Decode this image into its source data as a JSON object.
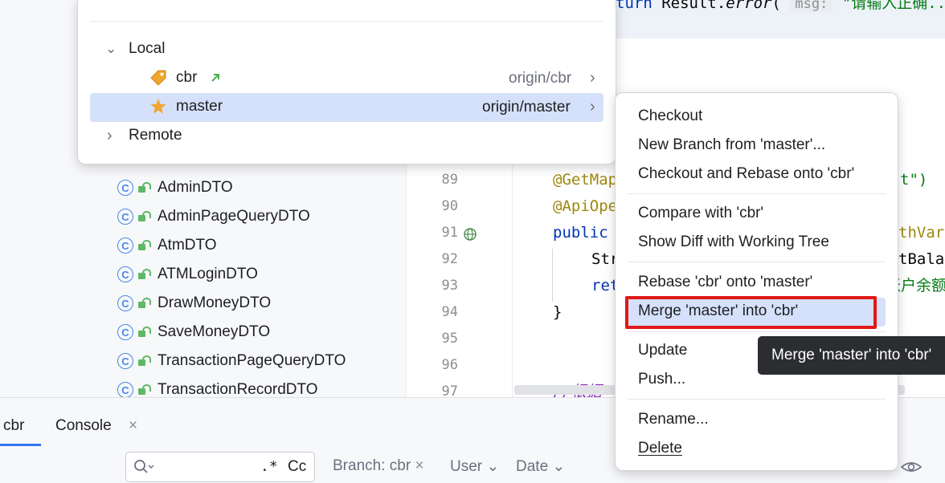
{
  "tree": {
    "items": [
      {
        "label": "AdminDTO"
      },
      {
        "label": "AdminPageQueryDTO"
      },
      {
        "label": "AtmDTO"
      },
      {
        "label": "ATMLoginDTO"
      },
      {
        "label": "DrawMoneyDTO"
      },
      {
        "label": "SaveMoneyDTO"
      },
      {
        "label": "TransactionPageQueryDTO"
      },
      {
        "label": "TransactionRecordDTO"
      }
    ],
    "class_glyph": "C",
    "class_icon": "class-icon",
    "access_icon": "lock-icon"
  },
  "editor": {
    "top_line": {
      "kw": "turn",
      "plain": " Result.",
      "method": "error",
      "paren": "(",
      "hint": "msg:",
      "str": "\"请输入正确..."
    },
    "line_numbers": [
      "89",
      "90",
      "91",
      "92",
      "93",
      "94",
      "95",
      "96",
      "97"
    ],
    "lines": {
      "l89_annot": "@GetMap",
      "l89_tail": "\")",
      "l89_tail_str": "t",
      "l90_annot": "@ApiOpe",
      "l91_kw": "public",
      "l91_tail": "thVar",
      "l92_plain": "Str",
      "l92_tail": "tBala",
      "l93_kw": "ret",
      "l93_tail": "账户余额",
      "l94_plain": "}",
      "l97_cmt": "//根据"
    }
  },
  "branches_popup": {
    "local_label": "Local",
    "remote_label": "Remote",
    "branches": [
      {
        "name": "cbr",
        "tracking": "origin/cbr",
        "icon": "tag-icon",
        "status_icon": "outgoing-arrow-icon"
      },
      {
        "name": "master",
        "tracking": "origin/master",
        "icon": "star-icon",
        "selected": true
      }
    ]
  },
  "context_menu": {
    "items": [
      {
        "label": "Checkout"
      },
      {
        "label": "New Branch from 'master'..."
      },
      {
        "label": "Checkout and Rebase onto 'cbr'"
      },
      {
        "label": "Compare with 'cbr'"
      },
      {
        "label": "Show Diff with Working Tree"
      },
      {
        "label": "Rebase 'cbr' onto 'master'"
      },
      {
        "label": "Merge 'master' into 'cbr'",
        "highlighted": true
      },
      {
        "label": "Update"
      },
      {
        "label": "Push..."
      },
      {
        "label": "Rename..."
      },
      {
        "label": "Delete"
      }
    ]
  },
  "tooltip": {
    "text": "Merge 'master' into 'cbr'"
  },
  "bottom_panel": {
    "tabs": [
      {
        "label": "cbr",
        "active": true
      },
      {
        "label": "Console",
        "closable": true
      }
    ],
    "close_glyph": "×",
    "search": {
      "placeholder": "",
      "regex_label": ".*",
      "case_label": "Cc"
    },
    "filters": {
      "branch_label": "Branch: cbr",
      "user_label": "User",
      "date_label": "Date"
    }
  },
  "colors": {
    "accent": "#3574f0",
    "selection": "#d5e1fa",
    "highlight_border": "#e01919",
    "tooltip_bg": "#2b2d30"
  }
}
